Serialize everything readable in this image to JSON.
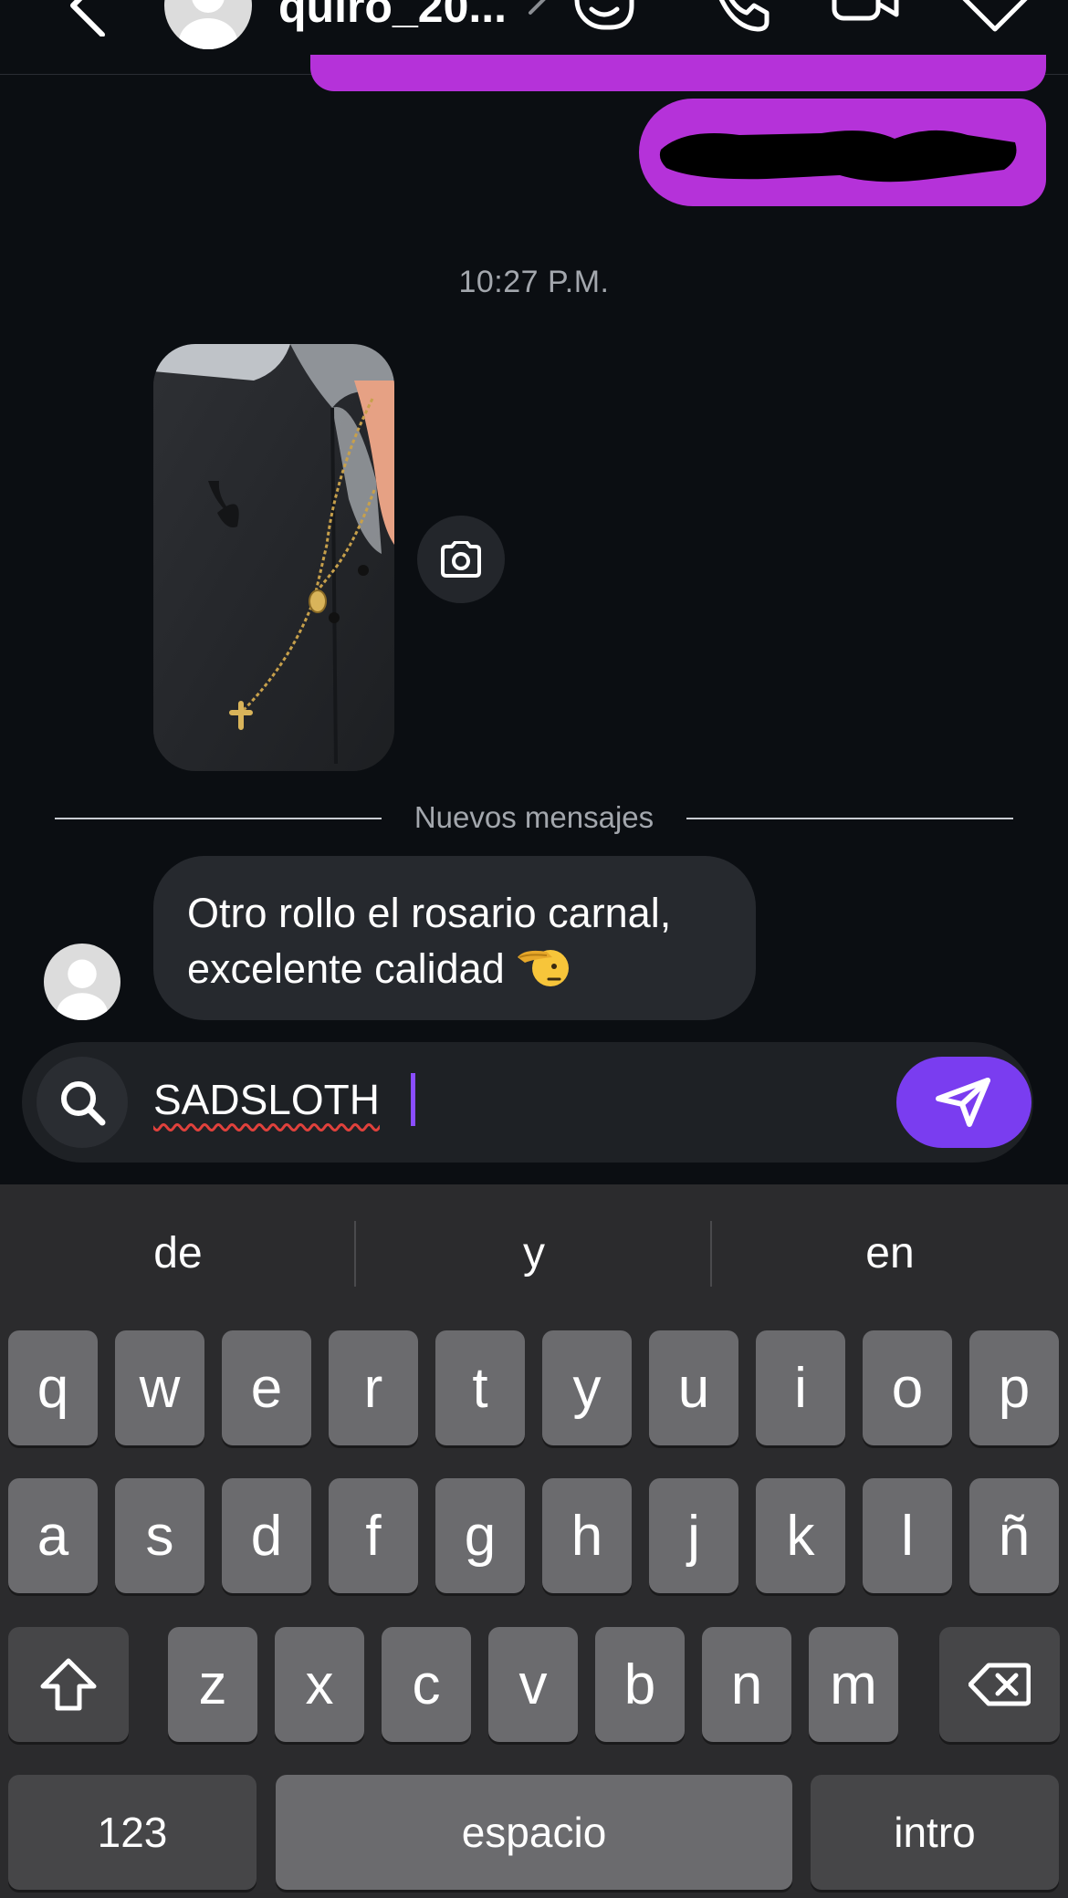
{
  "header": {
    "contact_name": "quiro_20...",
    "icons": [
      "back-arrow-icon",
      "sticker-icon",
      "phone-icon",
      "video-icon",
      "tag-icon"
    ]
  },
  "chat": {
    "timestamp": "10:27 P.M.",
    "new_messages_label": "Nuevos mensajes",
    "received_message_line1": "Otro rollo el rosario carnal,",
    "received_message_line2": "excelente calidad",
    "received_message_emoji": "saluting-face-emoji"
  },
  "composer": {
    "value": "SADSLOTH",
    "icons": [
      "search-icon",
      "send-icon"
    ]
  },
  "keyboard": {
    "suggestions": [
      "de",
      "y",
      "en"
    ],
    "row1": [
      "q",
      "w",
      "e",
      "r",
      "t",
      "y",
      "u",
      "i",
      "o",
      "p"
    ],
    "row2": [
      "a",
      "s",
      "d",
      "f",
      "g",
      "h",
      "j",
      "k",
      "l",
      "ñ"
    ],
    "row3": [
      "z",
      "x",
      "c",
      "v",
      "b",
      "n",
      "m"
    ],
    "numbers_label": "123",
    "space_label": "espacio",
    "return_label": "intro"
  },
  "colors": {
    "sent_bubble": "#b532d9",
    "received_bubble": "#26292e",
    "send_button": "#7a3df0",
    "background": "#0b0e12"
  }
}
